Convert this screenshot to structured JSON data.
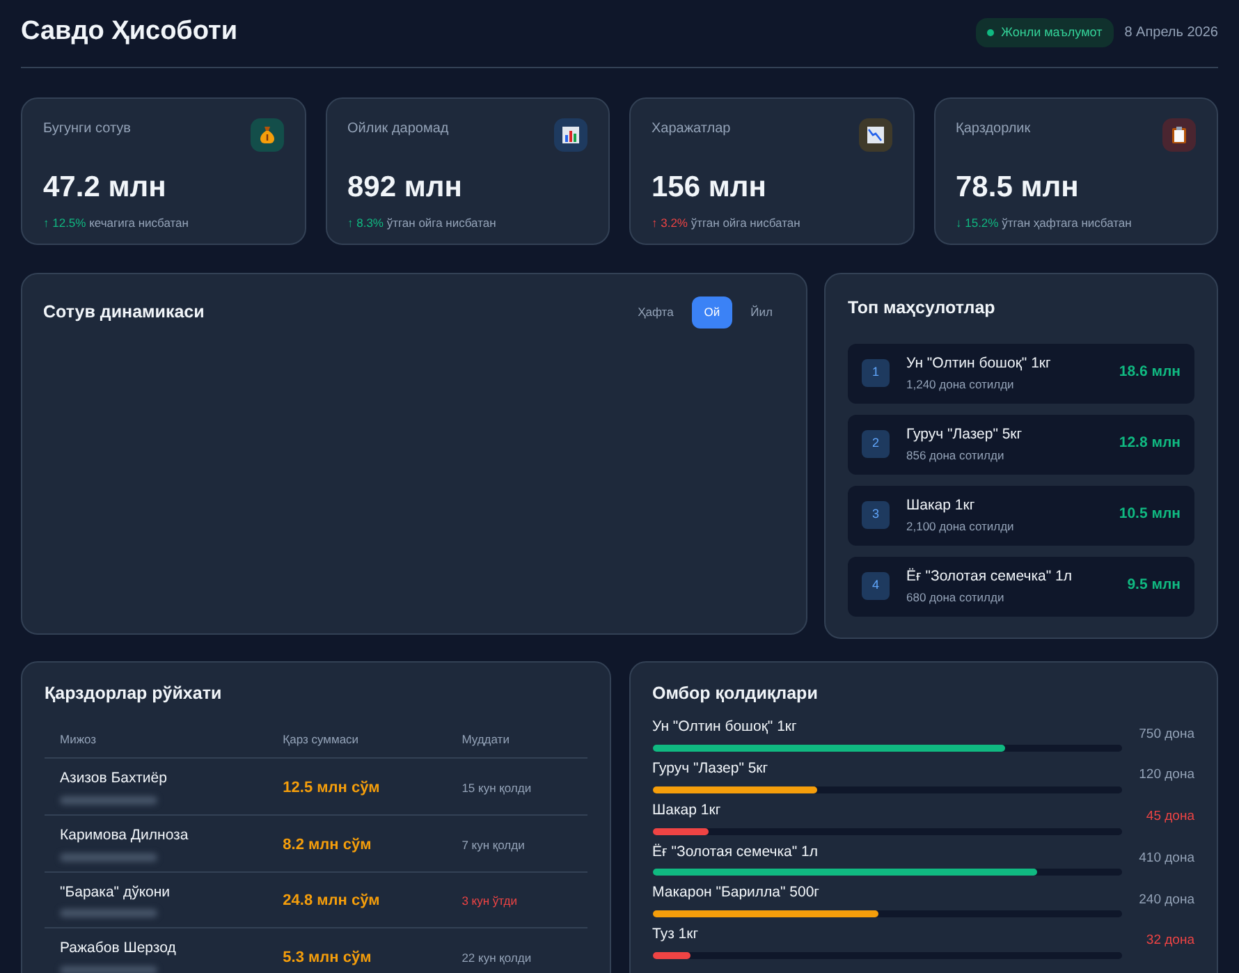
{
  "header": {
    "title": "Савдо Ҳисоботи",
    "live_badge": "Жонли маълумот",
    "date": "8 Апрель 2026"
  },
  "kpis": [
    {
      "kind": "sales",
      "label": "Бугунги сотув",
      "value": "47.2 млн",
      "trend": "↑ 12.5%",
      "trend_good": true,
      "note": "кечагига нисбатан"
    },
    {
      "kind": "revenue",
      "label": "Ойлик даромад",
      "value": "892 млн",
      "trend": "↑ 8.3%",
      "trend_good": true,
      "note": "ўтган ойга нисбатан"
    },
    {
      "kind": "expenses",
      "label": "Харажатлар",
      "value": "156 млн",
      "trend": "↑ 3.2%",
      "trend_good": false,
      "note": "ўтган ойга нисбатан"
    },
    {
      "kind": "debt",
      "label": "Қарздорлик",
      "value": "78.5 млн",
      "trend": "↓ 15.2%",
      "trend_good": true,
      "note": "ўтган ҳафтага нисбатан"
    }
  ],
  "sales_chart": {
    "title": "Сотув динамикаси",
    "periods": [
      {
        "label": "Ҳафта",
        "selected": false
      },
      {
        "label": "Ой",
        "selected": true
      },
      {
        "label": "Йил",
        "selected": false
      }
    ]
  },
  "top_products": {
    "title": "Топ маҳсулотлар",
    "items": [
      {
        "rank": "1",
        "name": "Ун \"Олтин бошоқ\" 1кг",
        "sold": "1,240 дона сотилди",
        "amount": "18.6 млн"
      },
      {
        "rank": "2",
        "name": "Гуруч \"Лазер\" 5кг",
        "sold": "856 дона сотилди",
        "amount": "12.8 млн"
      },
      {
        "rank": "3",
        "name": "Шакар 1кг",
        "sold": "2,100 дона сотилди",
        "amount": "10.5 млн"
      },
      {
        "rank": "4",
        "name": "Ёғ \"Золотая семечка\" 1л",
        "sold": "680 дона сотилди",
        "amount": "9.5 млн"
      }
    ]
  },
  "debtors": {
    "title": "Қарздорлар рўйхати",
    "columns": [
      "Мижоз",
      "Қарз суммаси",
      "Муддати"
    ],
    "rows": [
      {
        "name": "Азизов Бахтиёр",
        "amount": "12.5 млн сўм",
        "term": "15 кун қолди",
        "overdue": false
      },
      {
        "name": "Каримова Дилноза",
        "amount": "8.2 млн сўм",
        "term": "7 кун қолди",
        "overdue": false
      },
      {
        "name": "\"Барака\" дўкони",
        "amount": "24.8 млн сўм",
        "term": "3 кун ўтди",
        "overdue": true
      },
      {
        "name": "Ражабов Шерзод",
        "amount": "5.3 млн сўм",
        "term": "22 кун қолди",
        "overdue": false
      }
    ]
  },
  "stock": {
    "title": "Омбор қолдиқлари",
    "items": [
      {
        "name": "Ун \"Олтин бошоқ\" 1кг",
        "reading": "750 дона",
        "level": 0.75,
        "color": "#10b981",
        "alert": false
      },
      {
        "name": "Гуруч \"Лазер\" 5кг",
        "reading": "120 дона",
        "level": 0.35,
        "color": "#f59e0b",
        "alert": false
      },
      {
        "name": "Шакар 1кг",
        "reading": "45 дона",
        "level": 0.12,
        "color": "#ef4444",
        "alert": true
      },
      {
        "name": "Ёғ \"Золотая семечка\" 1л",
        "reading": "410 дона",
        "level": 0.82,
        "color": "#10b981",
        "alert": false
      },
      {
        "name": "Макарон \"Барилла\" 500г",
        "reading": "240 дона",
        "level": 0.48,
        "color": "#f59e0b",
        "alert": false
      },
      {
        "name": "Туз 1кг",
        "reading": "32 дона",
        "level": 0.08,
        "color": "#ef4444",
        "alert": true
      }
    ]
  }
}
